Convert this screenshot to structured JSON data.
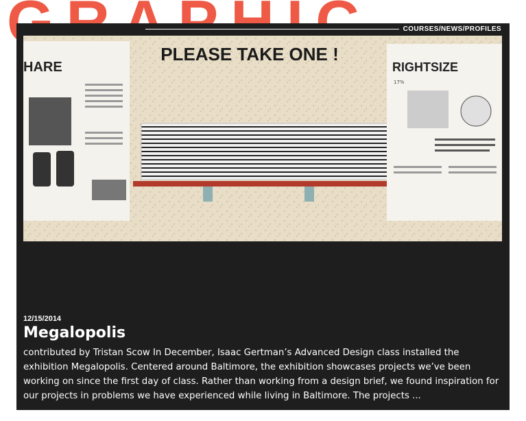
{
  "background_word": "GRAPHIC",
  "nav": {
    "label": "COURSES/NEWS/PROFILES"
  },
  "photo": {
    "headline": "PLEASE TAKE ONE !",
    "left_poster_title": "HARE",
    "right_poster_title": "RIGHTSIZE",
    "right_poster_percent": "17%",
    "right_poster_tagline": "Rightsize is a project about making Baltimore better.",
    "right_poster_note": "To increase population density through house relocation and property reform"
  },
  "post": {
    "date": "12/15/2014",
    "title": "Megalopolis",
    "excerpt": "contributed by Tristan Scow In December, Isaac Gertman’s Advanced Design class installed the exhibition Megalopolis. Centered around Baltimore, the exhibition showcases projects we’ve been working on since the first day of class. Rather than working from a design brief, we found inspiration for our projects in problems we have experienced while living in Baltimore. The projects ..."
  },
  "colors": {
    "accent": "#ee5a45",
    "card": "#1e1e1e",
    "text": "#ffffff"
  }
}
